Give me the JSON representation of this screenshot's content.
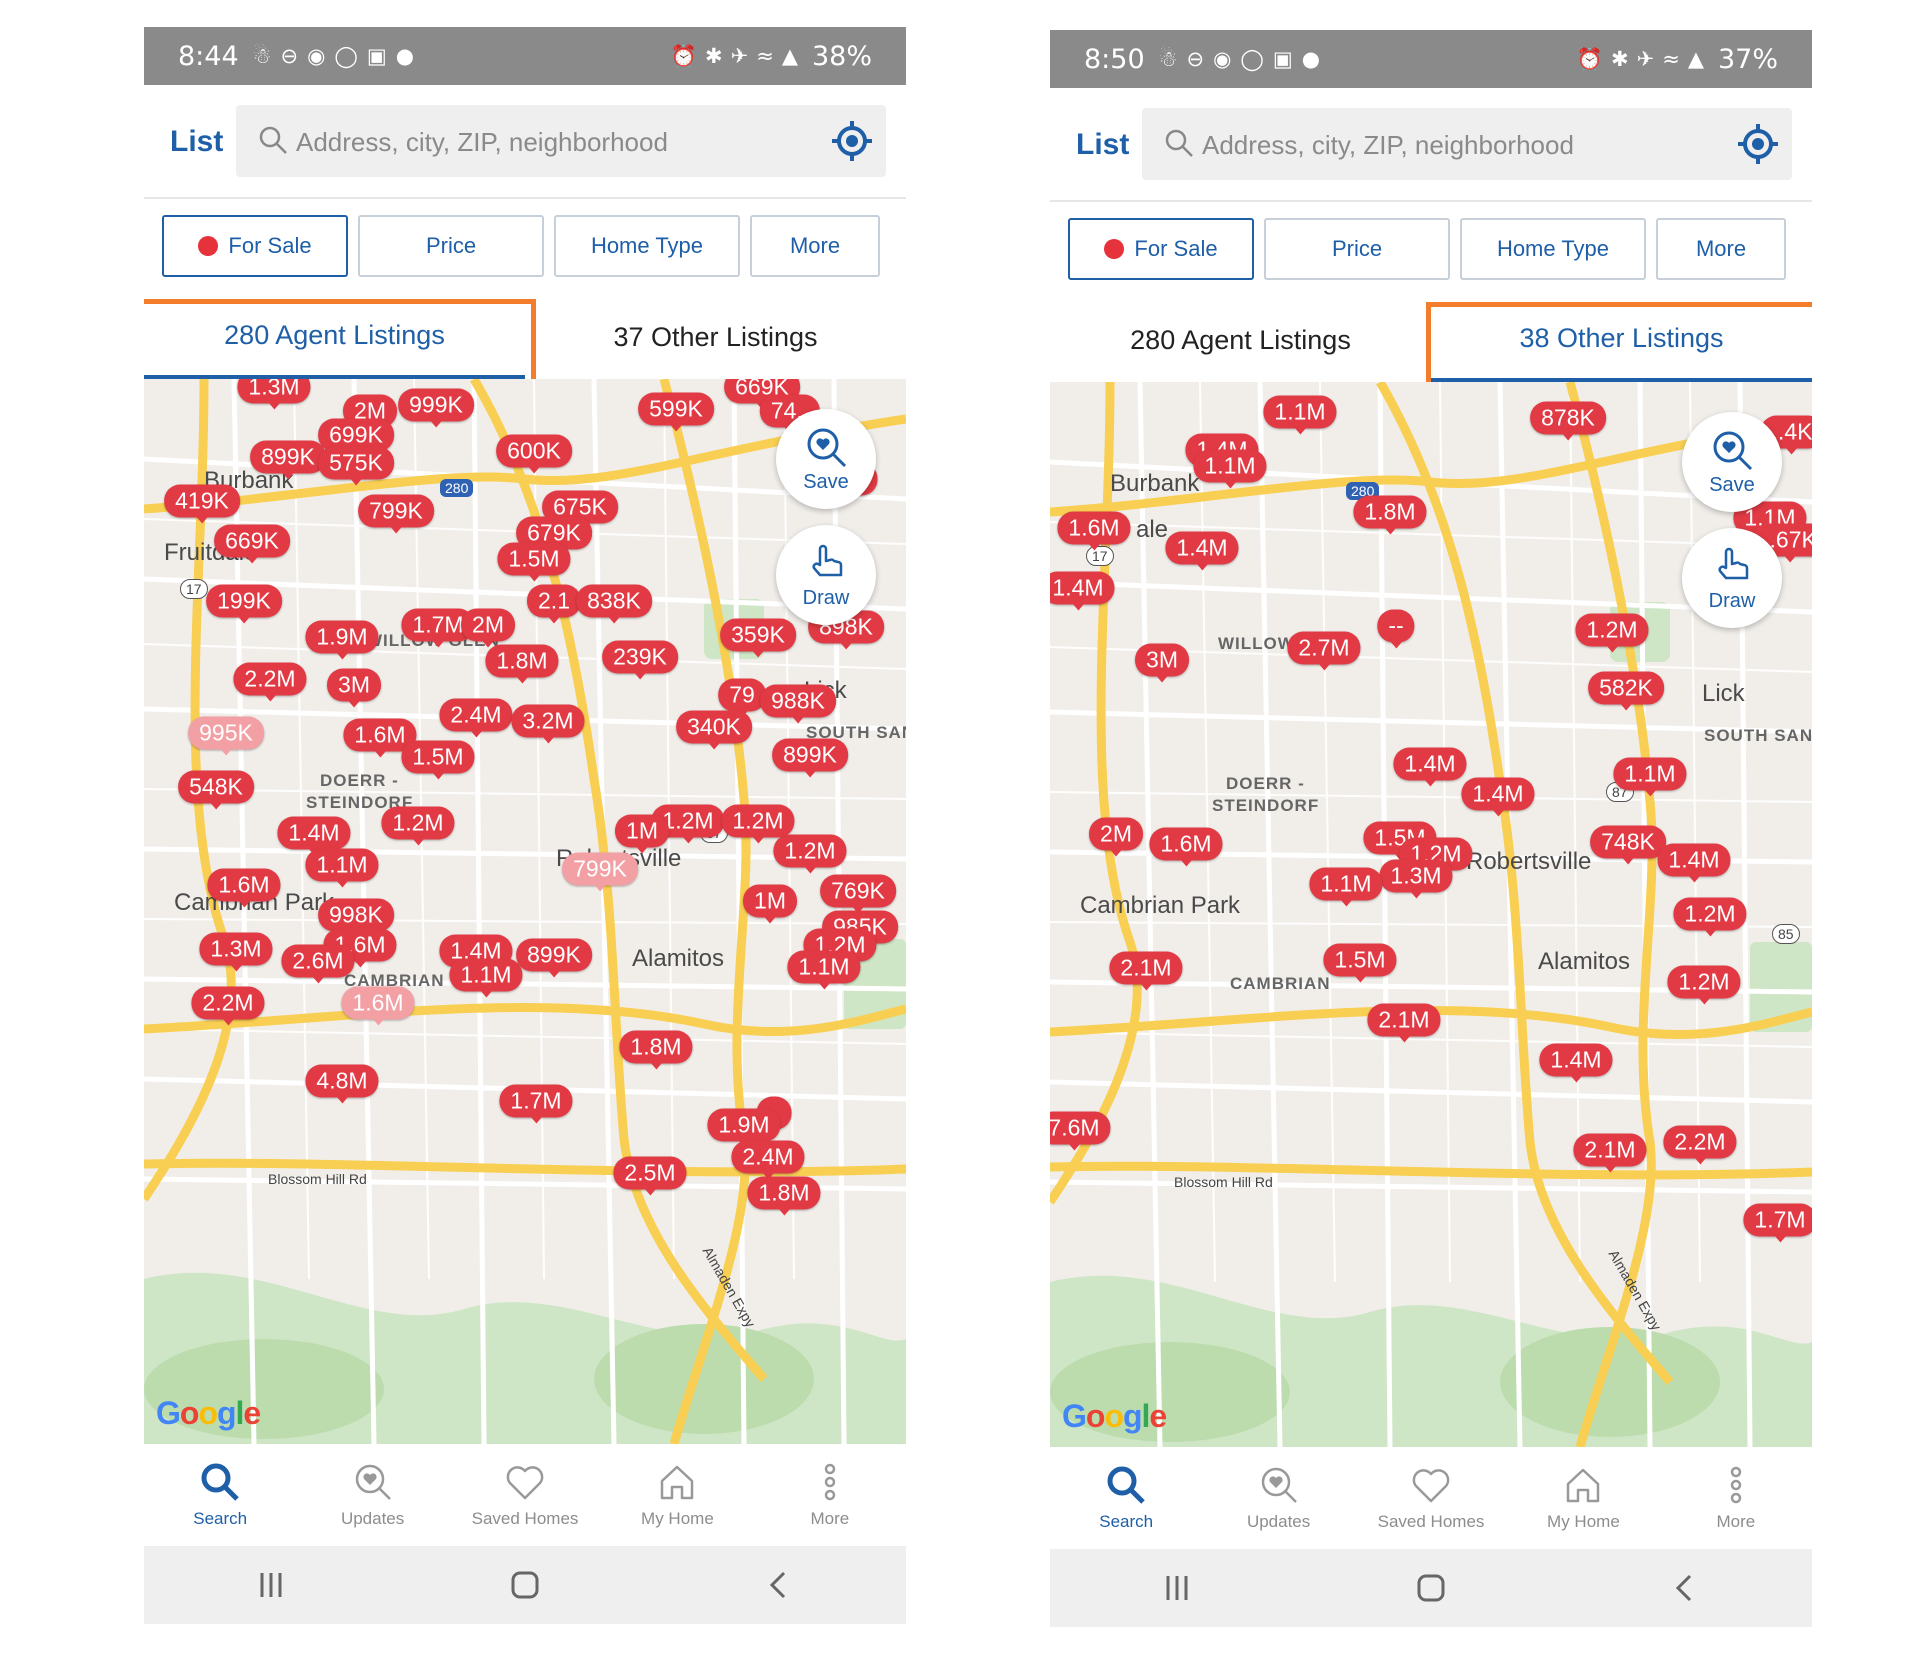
{
  "screens": [
    {
      "status": {
        "time": "8:44",
        "battery": "38%"
      },
      "header": {
        "list_label": "List",
        "search_placeholder": "Address, city, ZIP, neighborhood"
      },
      "filters": {
        "for_sale": "For Sale",
        "price": "Price",
        "home_type": "Home Type",
        "more": "More"
      },
      "tabs": {
        "agent": "280 Agent Listings",
        "other": "37 Other Listings",
        "active": "agent"
      },
      "map": {
        "save_label": "Save",
        "draw_label": "Draw",
        "attribution": "Google",
        "places": [
          "Burbank",
          "Fruitdale",
          "DOERR -",
          "STEINDORF",
          "Robertsville",
          "Alamitos",
          "Cambrian Park",
          "CAMBRIAN",
          "Lick",
          "SOUTH SAN",
          "Blossom Hill Rd",
          "Almaden Expy",
          "WILLOW GLEN"
        ],
        "shields": [
          "280",
          "17",
          "87"
        ],
        "markers": [
          "1.3M",
          "2M",
          "999K",
          "669K",
          "599K",
          "74..",
          "699K",
          "899K",
          "575K",
          "600K",
          "419K",
          "799K",
          "675K",
          "..8K",
          "669K",
          "679K",
          "1.5M",
          "199K",
          "2.1",
          "838K",
          "1.7M",
          "2M",
          "1.9M",
          "359K",
          "898K",
          "1.8M",
          "239K",
          "2.2M",
          "3M",
          "79",
          "988K",
          "2.4M",
          "3.2M",
          "995K",
          "1.6M",
          "1.5M",
          "340K",
          "899K",
          "548K",
          "1.4M",
          "1.2M",
          "1.2M",
          "1.2M",
          "1M",
          "799K",
          "1.2M",
          "1.1M",
          "1.6M",
          "998K",
          "1M",
          "769K",
          "985K",
          "1.3M",
          "1.6M",
          "2.6M",
          "1.4M",
          "899K",
          "1.1M",
          "1.2M",
          "1.1M",
          "2.2M",
          "1.6M",
          "1.8M",
          "4.8M",
          "1.7M",
          "..",
          "1.9M",
          "2.4M",
          "2.5M",
          "1.8M"
        ]
      },
      "nav": {
        "search": "Search",
        "updates": "Updates",
        "saved": "Saved Homes",
        "myhome": "My Home",
        "more": "More"
      }
    },
    {
      "status": {
        "time": "8:50",
        "battery": "37%"
      },
      "header": {
        "list_label": "List",
        "search_placeholder": "Address, city, ZIP, neighborhood"
      },
      "filters": {
        "for_sale": "For Sale",
        "price": "Price",
        "home_type": "Home Type",
        "more": "More"
      },
      "tabs": {
        "agent": "280 Agent Listings",
        "other": "38 Other Listings",
        "active": "other"
      },
      "map": {
        "save_label": "Save",
        "draw_label": "Draw",
        "attribution": "Google",
        "places": [
          "Burbank",
          "DOERR -",
          "STEINDORF",
          "Robertsville",
          "Alamitos",
          "Cambrian Park",
          "CAMBRIAN",
          "Lick",
          "SOUTH SAN",
          "Blossom Hill Rd",
          "Almaden Expy",
          "WILLOW",
          "ale"
        ],
        "shields": [
          "280",
          "17",
          "87",
          "85"
        ],
        "markers": [
          "1.1M",
          "878K",
          "..4K",
          "1.4M",
          "1.1M",
          "1.8M",
          "1.1M",
          "..67K",
          "1.6M",
          "1.4M",
          "1.4M",
          "--",
          "2.7M",
          "1.2M",
          "3M",
          "582K",
          "1.4M",
          "1.4M",
          "1.1M",
          "2M",
          "1.6M",
          "1.5M",
          "748K",
          "1.2M",
          "1.3M",
          "1.4M",
          "1.1M",
          "1.2M",
          "2.1M",
          "1.5M",
          "1.2M",
          "2.1M",
          "1.4M",
          "7.6M",
          "2.1M",
          "2.2M",
          "1.7M"
        ]
      },
      "nav": {
        "search": "Search",
        "updates": "Updates",
        "saved": "Saved Homes",
        "myhome": "My Home",
        "more": "More"
      }
    }
  ],
  "colors": {
    "accent": "#1e5fa8",
    "marker": "#e23a44",
    "marker_faded": "#f3a0a5",
    "highlight": "#f37d2a",
    "statusbar": "#8a8a8a",
    "map_bg": "#f1eeea",
    "road": "#ffffff",
    "highway": "#f8cf52",
    "park": "#cfe6c6"
  }
}
